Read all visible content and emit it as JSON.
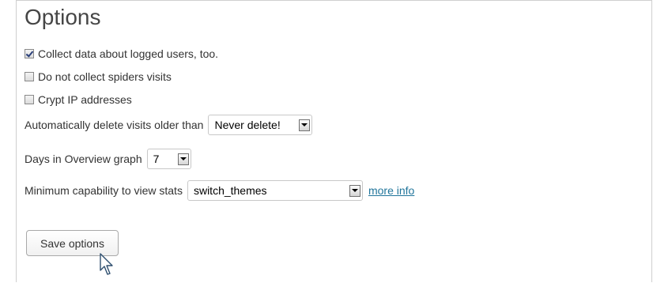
{
  "section": {
    "title": "Options"
  },
  "options": {
    "collect_logged_users": {
      "label": "Collect data about logged users, too.",
      "checked": true
    },
    "no_spiders": {
      "label": "Do not collect spiders visits",
      "checked": false
    },
    "crypt_ip": {
      "label": "Crypt IP addresses",
      "checked": false
    },
    "delete_visits": {
      "label": "Automatically delete visits older than",
      "value": "Never delete!"
    },
    "overview_days": {
      "label": "Days in Overview graph",
      "value": "7"
    },
    "min_capability": {
      "label": "Minimum capability to view stats",
      "value": "switch_themes",
      "link": "more info"
    }
  },
  "actions": {
    "save_label": "Save options"
  },
  "colors": {
    "link": "#21759b",
    "check": "#2a3f7a"
  },
  "icons": {
    "dropdown": "chevron-down-icon",
    "cursor": "mouse-pointer-icon"
  }
}
